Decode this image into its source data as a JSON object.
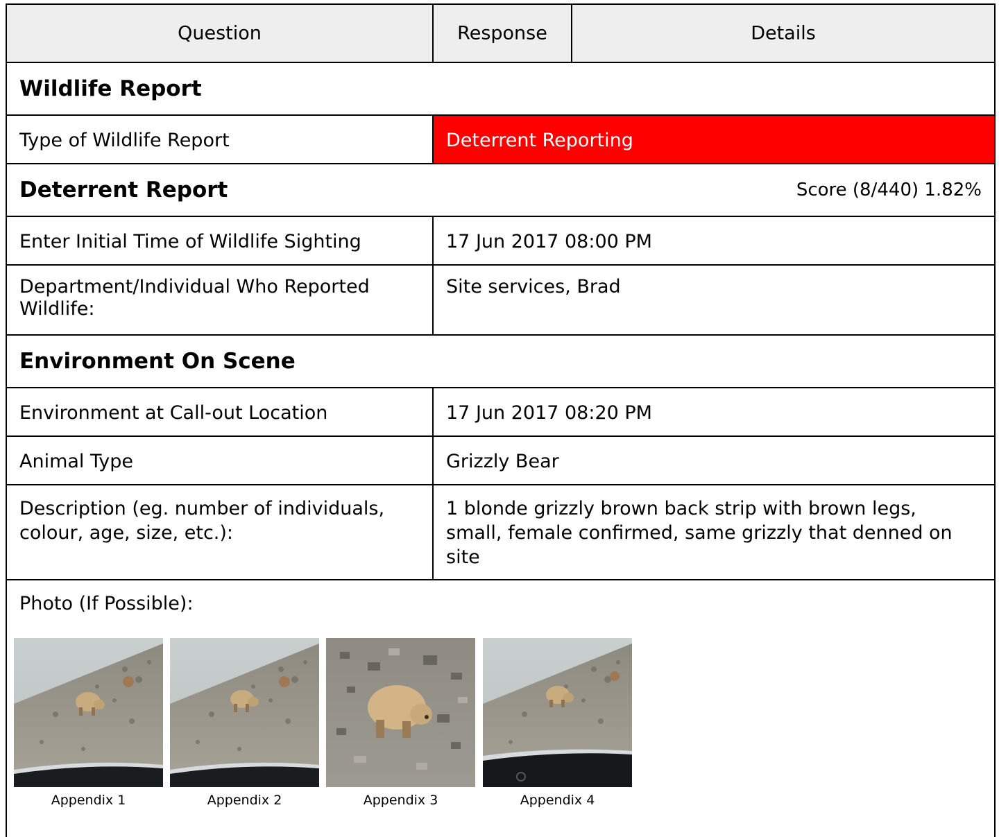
{
  "header": {
    "question": "Question",
    "response": "Response",
    "details": "Details"
  },
  "sections": {
    "wildlife_report": {
      "title": "Wildlife Report",
      "type_question": "Type of Wildlife Report",
      "type_answer": "Deterrent Reporting",
      "answer_color": "#ff0000"
    },
    "deterrent_report": {
      "title": "Deterrent Report",
      "score": "Score (8/440) 1.82%",
      "rows": [
        {
          "question": "Enter Initial Time of Wildlife Sighting",
          "answer": "17 Jun 2017 08:00 PM"
        },
        {
          "question": "Department/Individual Who Reported Wildlife:",
          "answer": "Site services, Brad"
        }
      ]
    },
    "environment_on_scene": {
      "title": "Environment On Scene",
      "rows": [
        {
          "question": "Environment at Call-out Location",
          "answer": "17 Jun 2017 08:20 PM"
        },
        {
          "question": "Animal Type",
          "answer": "Grizzly Bear"
        },
        {
          "question": "Description (eg. number of individuals, colour, age, size, etc.):",
          "answer": "1 blonde grizzly brown back strip with brown legs, small, female confirmed, same grizzly that denned on site"
        }
      ],
      "photo_label": "Photo (If Possible):",
      "photos": [
        {
          "caption": "Appendix 1",
          "icon": "bear-photo"
        },
        {
          "caption": "Appendix 2",
          "icon": "bear-photo"
        },
        {
          "caption": "Appendix 3",
          "icon": "bear-photo"
        },
        {
          "caption": "Appendix 4",
          "icon": "bear-photo"
        }
      ]
    }
  }
}
